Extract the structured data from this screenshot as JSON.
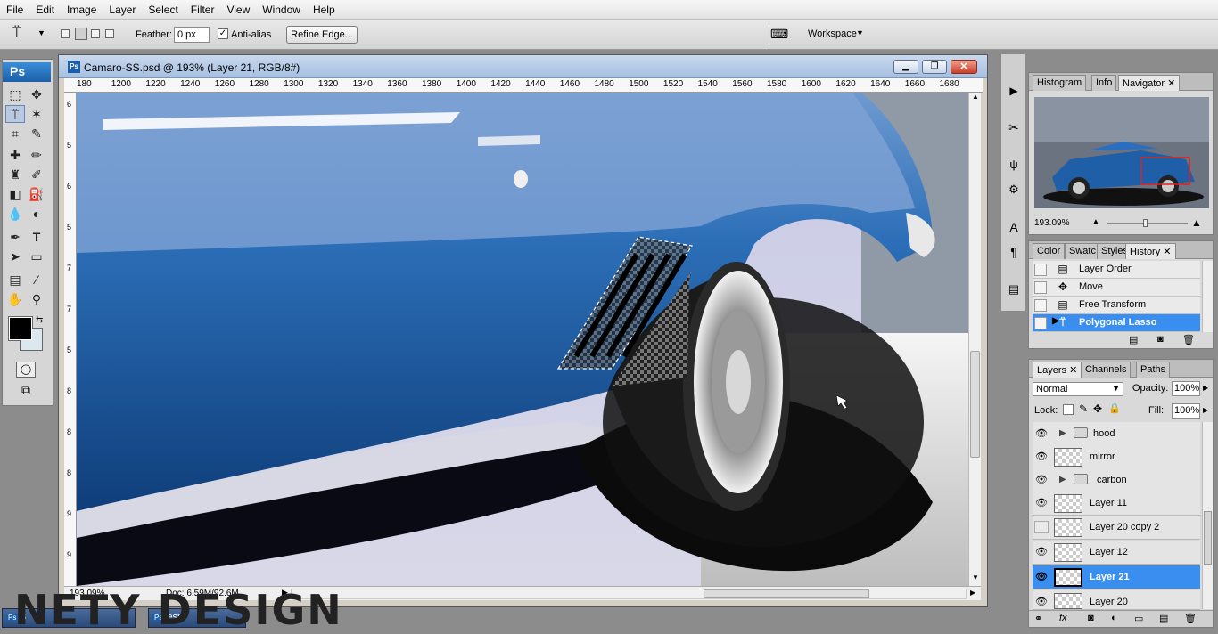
{
  "menu": [
    "File",
    "Edit",
    "Image",
    "Layer",
    "Select",
    "Filter",
    "View",
    "Window",
    "Help"
  ],
  "options": {
    "feather_label": "Feather:",
    "feather_value": "0 px",
    "antialias_label": "Anti-alias",
    "antialias_checked": true,
    "refine_edge": "Refine Edge...",
    "workspace": "Workspace"
  },
  "toolbox": {
    "badge": "Ps"
  },
  "document": {
    "title": "Camaro-SS.psd @ 193% (Layer 21, RGB/8#)",
    "ruler_top": [
      "180",
      "1200",
      "1220",
      "1240",
      "1260",
      "1280",
      "1300",
      "1320",
      "1340",
      "1360",
      "1380",
      "1400",
      "1420",
      "1440",
      "1460",
      "1480",
      "1500",
      "1520",
      "1540",
      "1560",
      "1580",
      "1600",
      "1620",
      "1640",
      "1660",
      "1680"
    ],
    "ruler_left": [
      "6",
      "5",
      "6",
      "5",
      "7",
      "7",
      "5",
      "8",
      "8",
      "8",
      "9",
      "9"
    ],
    "zoom": "193.09%",
    "doc_size": "Doc: 6.59M/92.6M"
  },
  "navigator": {
    "tabs": [
      "Histogram",
      "Info",
      "Navigator"
    ],
    "active_tab": "Navigator",
    "zoom": "193.09%"
  },
  "history": {
    "tabs": [
      "Color",
      "Swatc",
      "Styles",
      "History"
    ],
    "active_tab": "History",
    "items": [
      {
        "label": "Layer Order",
        "icon": "document-icon"
      },
      {
        "label": "Move",
        "icon": "move-icon"
      },
      {
        "label": "Free Transform",
        "icon": "document-icon"
      },
      {
        "label": "Polygonal Lasso",
        "icon": "polygonal-lasso-icon",
        "selected": true
      }
    ]
  },
  "layers": {
    "tabs": [
      "Layers",
      "Channels",
      "Paths"
    ],
    "active_tab": "Layers",
    "blend_mode": "Normal",
    "opacity_label": "Opacity:",
    "opacity": "100%",
    "lock_label": "Lock:",
    "fill_label": "Fill:",
    "fill": "100%",
    "items": [
      {
        "name": "hood",
        "type": "group",
        "visible": true
      },
      {
        "name": "mirror",
        "type": "layer",
        "visible": true
      },
      {
        "name": "carbon",
        "type": "group",
        "visible": true
      },
      {
        "name": "Layer 11",
        "type": "layer",
        "visible": true
      },
      {
        "name": "Layer 20 copy 2",
        "type": "layer",
        "visible": false
      },
      {
        "name": "Layer 12",
        "type": "layer",
        "visible": true
      },
      {
        "name": "Layer 21",
        "type": "layer",
        "visible": true,
        "selected": true
      },
      {
        "name": "Layer 20",
        "type": "layer",
        "visible": true
      }
    ]
  },
  "taskbar": {
    "items": [
      "8",
      "esn"
    ]
  },
  "watermark": "NETY DESIGN",
  "colors": {
    "selection": "#3a8ef0",
    "title_bar": "#a7c0e0",
    "car_blue": "#1f5fa8"
  }
}
